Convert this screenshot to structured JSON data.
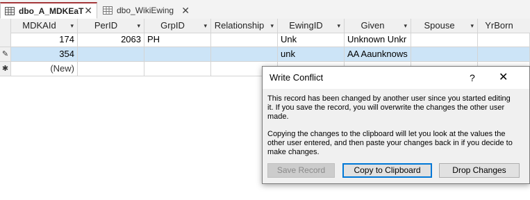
{
  "tabs": [
    {
      "label": "dbo_A_MDKEaT",
      "close": "✕"
    },
    {
      "label": "dbo_WikiEwing",
      "close": "✕"
    }
  ],
  "columns": [
    {
      "label": "MDKAId",
      "arrow": "▾"
    },
    {
      "label": "PerID",
      "arrow": "▾"
    },
    {
      "label": "GrpID",
      "arrow": "▾"
    },
    {
      "label": "Relationship",
      "arrow": "▾"
    },
    {
      "label": "EwingID",
      "arrow": "▾"
    },
    {
      "label": "Given",
      "arrow": "▾"
    },
    {
      "label": "Spouse",
      "arrow": "▾"
    },
    {
      "label": "YrBorn",
      "arrow": ""
    }
  ],
  "rows": [
    {
      "selector": "",
      "cells": [
        "174",
        "2063",
        "PH",
        "",
        "Unk",
        "Unknown Unkr",
        "",
        ""
      ]
    },
    {
      "selector": "✎",
      "cells": [
        "354",
        "",
        "",
        "",
        "unk",
        "AA Aaunknows",
        "",
        ""
      ]
    },
    {
      "selector": "✱",
      "cells": [
        "(New)",
        "",
        "",
        "",
        "",
        "",
        "",
        ""
      ]
    }
  ],
  "dialog": {
    "title": "Write Conflict",
    "help": "?",
    "close": "✕",
    "message1": "This record has been changed by another user since you started editing it.  If you save the record, you will overwrite the changes the other user made.",
    "message2": "Copying the changes to the clipboard will let you look at the values the other user entered, and then paste your changes back in if you decide to make changes.",
    "buttons": {
      "save": "Save Record",
      "copy": "Copy to Clipboard",
      "drop": "Drop Changes"
    }
  }
}
